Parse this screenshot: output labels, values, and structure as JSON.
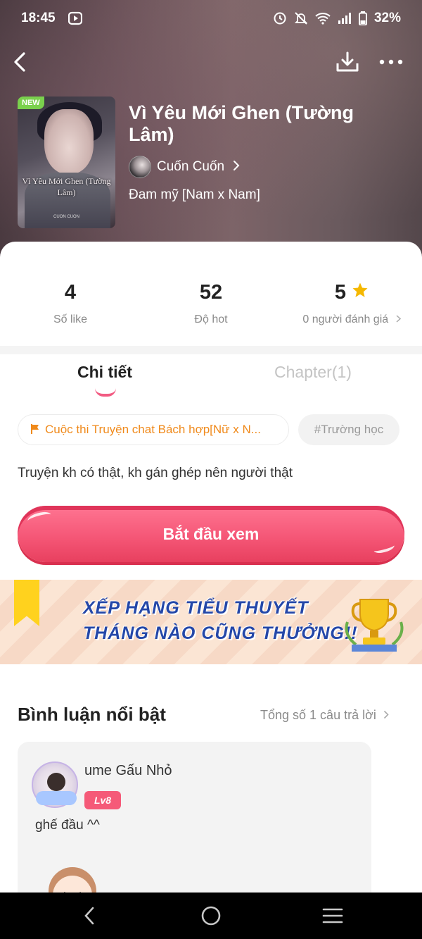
{
  "status_bar": {
    "time": "18:45",
    "battery": "32%"
  },
  "book": {
    "title": "Vì Yêu Mới Ghen (Tường Lâm)",
    "badge": "NEW",
    "cover_title": "Vì Yêu Mới Ghen (Tường Lâm)",
    "cover_author": "CUON CUON",
    "author": "Cuốn Cuốn",
    "genre": "Đam mỹ [Nam x Nam]"
  },
  "stats": {
    "likes": {
      "value": "4",
      "label": "Số like"
    },
    "hot": {
      "value": "52",
      "label": "Độ hot"
    },
    "rating": {
      "value": "5",
      "label": "0 người đánh giá"
    }
  },
  "tabs": {
    "details": "Chi tiết",
    "chapters": "Chapter(1)"
  },
  "tags": {
    "contest": "Cuộc thi Truyện chat Bách hợp[Nữ x N...",
    "hashtag": "#Trường học"
  },
  "description": "Truyện kh có thật, kh gán ghép nên người thật",
  "start_button": "Bắt đầu xem",
  "banner": {
    "line1": "XẾP HẠNG TIỂU THUYẾT",
    "line2": "THÁNG NÀO CŨNG THƯỞNG!!"
  },
  "comments": {
    "title": "Bình luận nổi bật",
    "count_label": "Tổng số 1 câu trả lời",
    "items": [
      {
        "user": "ume Gấu Nhỏ",
        "level": "Lv8",
        "text": "ghế đầu ^^"
      }
    ]
  },
  "colors": {
    "accent": "#f55a78",
    "contest": "#f08a1b",
    "star": "#f5b800"
  }
}
